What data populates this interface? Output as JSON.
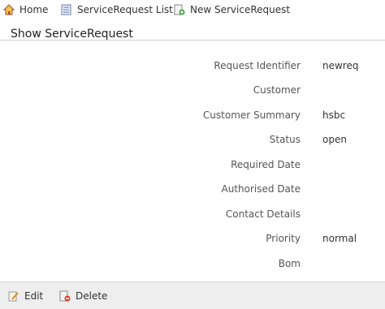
{
  "nav": {
    "home": {
      "label": "Home",
      "icon": "home-icon"
    },
    "list": {
      "label": "ServiceRequest List",
      "icon": "list-icon"
    },
    "new": {
      "label": "New ServiceRequest",
      "icon": "new-document-icon"
    }
  },
  "page": {
    "title": "Show ServiceRequest"
  },
  "fields": [
    {
      "label": "Request Identifier",
      "value": "newreq"
    },
    {
      "label": "Customer",
      "value": ""
    },
    {
      "label": "Customer Summary",
      "value": "hsbc"
    },
    {
      "label": "Status",
      "value": "open"
    },
    {
      "label": "Required Date",
      "value": ""
    },
    {
      "label": "Authorised Date",
      "value": ""
    },
    {
      "label": "Contact Details",
      "value": ""
    },
    {
      "label": "Priority",
      "value": "normal"
    },
    {
      "label": "Bom",
      "value": ""
    }
  ],
  "actions": {
    "edit": {
      "label": "Edit",
      "icon": "edit-icon"
    },
    "delete": {
      "label": "Delete",
      "icon": "delete-icon"
    }
  }
}
